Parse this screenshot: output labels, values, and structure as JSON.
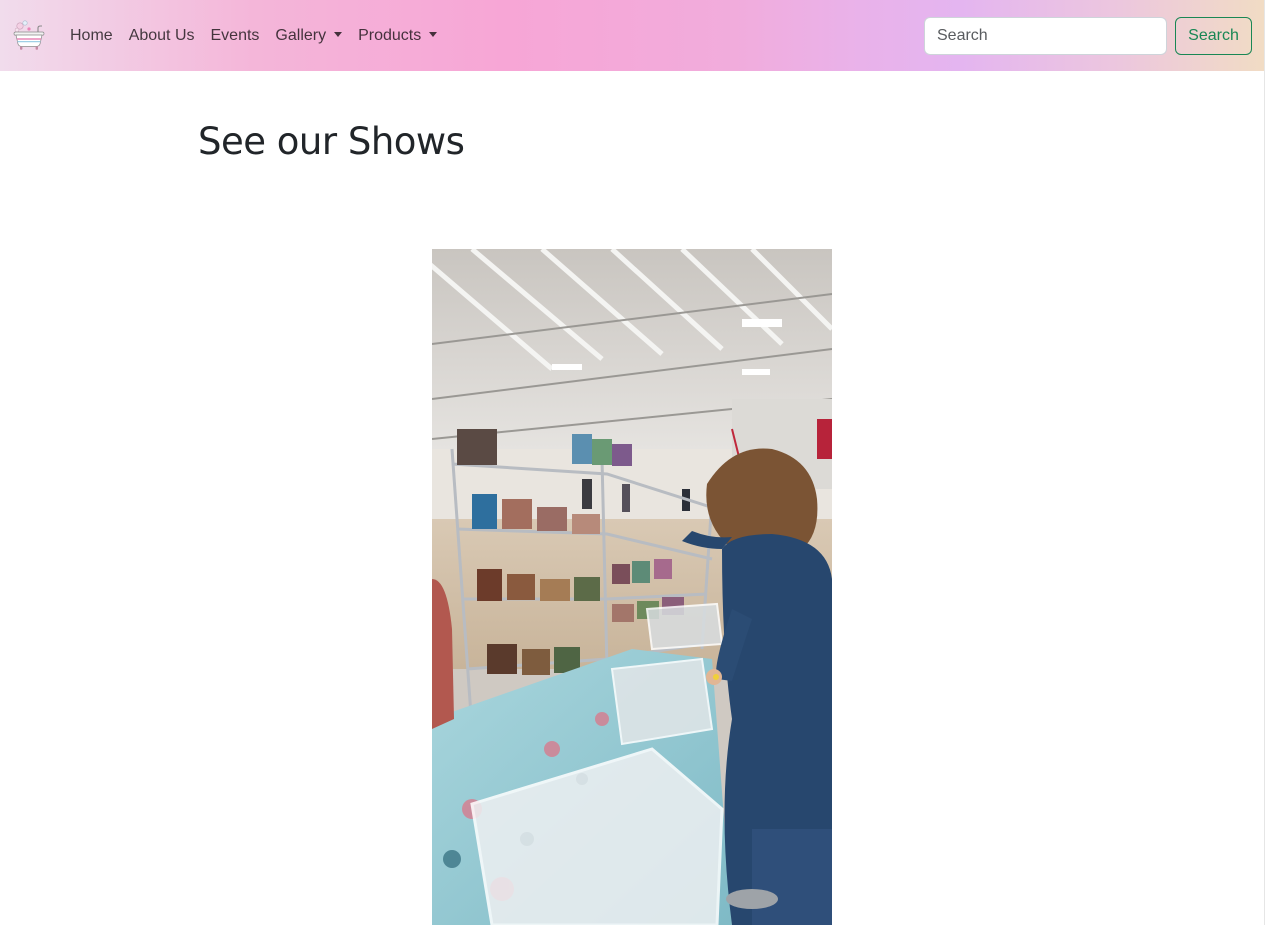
{
  "navbar": {
    "logo_icon": "bathtub-logo-icon",
    "links": [
      {
        "label": "Home",
        "dropdown": false
      },
      {
        "label": "About Us",
        "dropdown": false
      },
      {
        "label": "Events",
        "dropdown": false
      },
      {
        "label": "Gallery",
        "dropdown": true
      },
      {
        "label": "Products",
        "dropdown": true
      }
    ],
    "search": {
      "placeholder": "Search",
      "button_label": "Search"
    },
    "colors": {
      "gradient_start": "#f1dcec",
      "gradient_pink": "#f7a6d6",
      "gradient_lavender": "#e4b5f0",
      "gradient_end": "#f1dcc4",
      "search_button": "#198754"
    }
  },
  "main": {
    "title": "See our Shows",
    "photo": {
      "alt": "Vendor booth at an indoor show with soap bars on wire shelves"
    }
  }
}
